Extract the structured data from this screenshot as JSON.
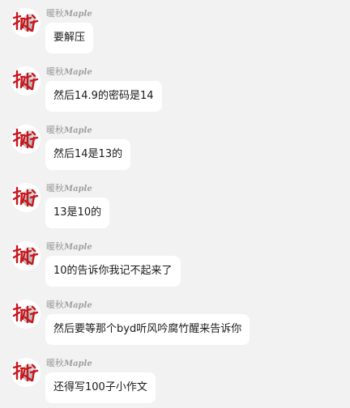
{
  "sender": {
    "name_cn": "暖秋",
    "name_en": "Maple",
    "avatar_icon": "red-calligraphy-avatar-icon"
  },
  "messages": [
    {
      "text": "要解压"
    },
    {
      "text": "然后14.9的密码是14"
    },
    {
      "text": "然后14是13的"
    },
    {
      "text": "13是10的"
    },
    {
      "text": "10的告诉你我记不起来了"
    },
    {
      "text": "然后要等那个byd听风吟腐竹醒来告诉你"
    },
    {
      "text": "还得写100子小作文"
    }
  ],
  "colors": {
    "background": "#f2f2f2",
    "bubble": "#ffffff",
    "sender_name": "#9a9a9a",
    "avatar_ink": "#c8161d"
  }
}
